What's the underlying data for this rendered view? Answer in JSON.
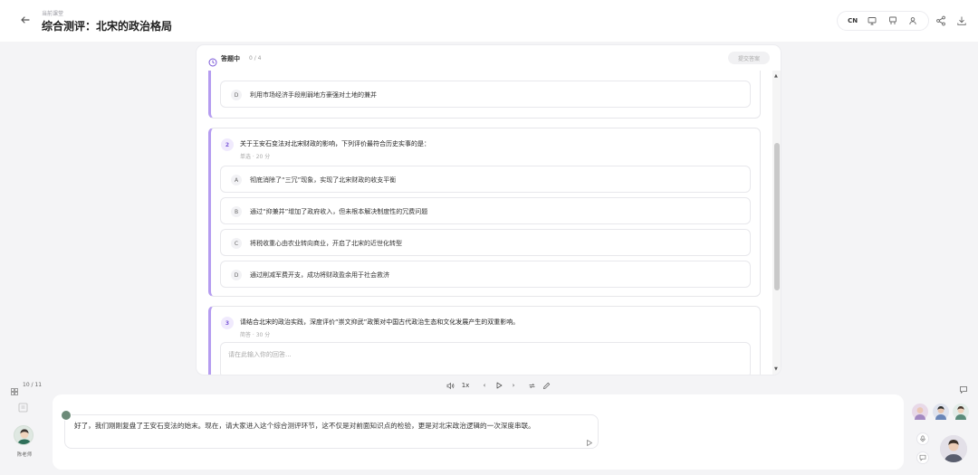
{
  "header": {
    "breadcrumb": "当前课堂",
    "title": "综合测评：北宋的政治格局",
    "lang_label": "CN"
  },
  "quiz": {
    "status_label": "答题中",
    "progress": "0 / 4",
    "submit_label": "提交答案",
    "prev_option": {
      "letter": "D",
      "text": "利用市场经济手段削弱地方豪强对土地的兼并"
    },
    "questions": [
      {
        "number": "2",
        "text": "关于王安石变法对北宋财政的影响，下列评价最符合历史实事的是：",
        "meta": "单选 · 20 分",
        "options": [
          {
            "letter": "A",
            "text": "彻底消除了“三冗”现象，实现了北宋财政的收支平衡"
          },
          {
            "letter": "B",
            "text": "通过“抑兼并”增加了政府收入，但未根本解决制度性的冗费问题"
          },
          {
            "letter": "C",
            "text": "将税收重心由农业转向商业，开启了北宋的近世化转型"
          },
          {
            "letter": "D",
            "text": "通过削减军费开支，成功将财政盈余用于社会救济"
          }
        ]
      },
      {
        "number": "3",
        "text": "请结合北宋的政治实践，深度评价“崇文抑武”政策对中国古代政治生态和文化发展产生的双重影响。",
        "meta": "简答 · 30 分",
        "answer_placeholder": "请在此输入你的回答..."
      }
    ]
  },
  "player": {
    "time": "10 / 11",
    "speed": "1x"
  },
  "chat": {
    "message": "好了，我们刚刚复盘了王安石变法的始末。现在，请大家进入这个综合测评环节，这不仅是对前面知识点的检验，更是对北宋政治逻辑的一次深度串联。",
    "teacher_name": "陈老师"
  },
  "colors": {
    "accent": "#b59cf0",
    "accent_text": "#7c5ad8"
  }
}
